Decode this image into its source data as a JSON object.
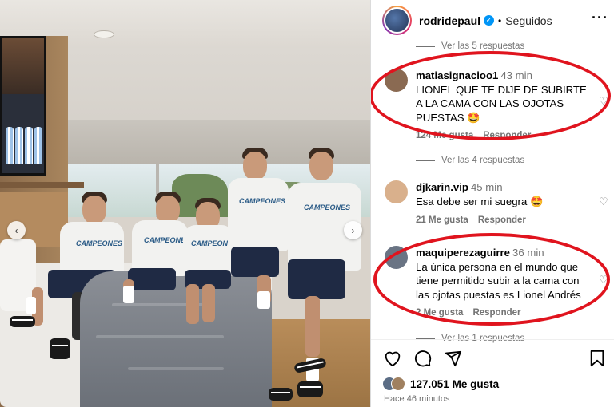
{
  "post": {
    "username": "rodridepaul",
    "separator": "•",
    "follow_status": "Seguidos",
    "more_icon": "more-horizontal-icon",
    "shirt_text": "CAMPEONES"
  },
  "comments": [
    {
      "type": "replies",
      "label": "Ver las 5 respuestas"
    },
    {
      "type": "comment",
      "user": "matiasignacioo1",
      "time": "43 min",
      "text": "LIONEL QUE TE DIJE DE SUBIRTE A LA CAMA CON LAS OJOTAS PUESTAS 🤩",
      "likes": "124 Me gusta",
      "reply": "Responder",
      "avatar_color": "#8a6a52"
    },
    {
      "type": "replies",
      "label": "Ver las 4 respuestas"
    },
    {
      "type": "comment",
      "user": "djkarin.vip",
      "time": "45 min",
      "text": "Esa debe ser mi suegra 🤩",
      "likes": "21 Me gusta",
      "reply": "Responder",
      "avatar_color": "#d9b08c"
    },
    {
      "type": "comment",
      "user": "maquiperezaguirre",
      "time": "36 min",
      "text": "La única persona en el mundo que tiene permitido subir a la cama con las ojotas puestas es Lionel Andrés",
      "likes": "2 Me gusta",
      "reply": "Responder",
      "avatar_color": "#6a7484"
    },
    {
      "type": "replies",
      "label": "Ver las 1 respuestas"
    }
  ],
  "footer": {
    "likes_count": "127.051",
    "likes_label": "Me gusta",
    "time_ago": "Hace 46 minutos"
  },
  "colors": {
    "highlight": "#e0141e",
    "verified": "#0095f6",
    "muted": "#737373"
  }
}
